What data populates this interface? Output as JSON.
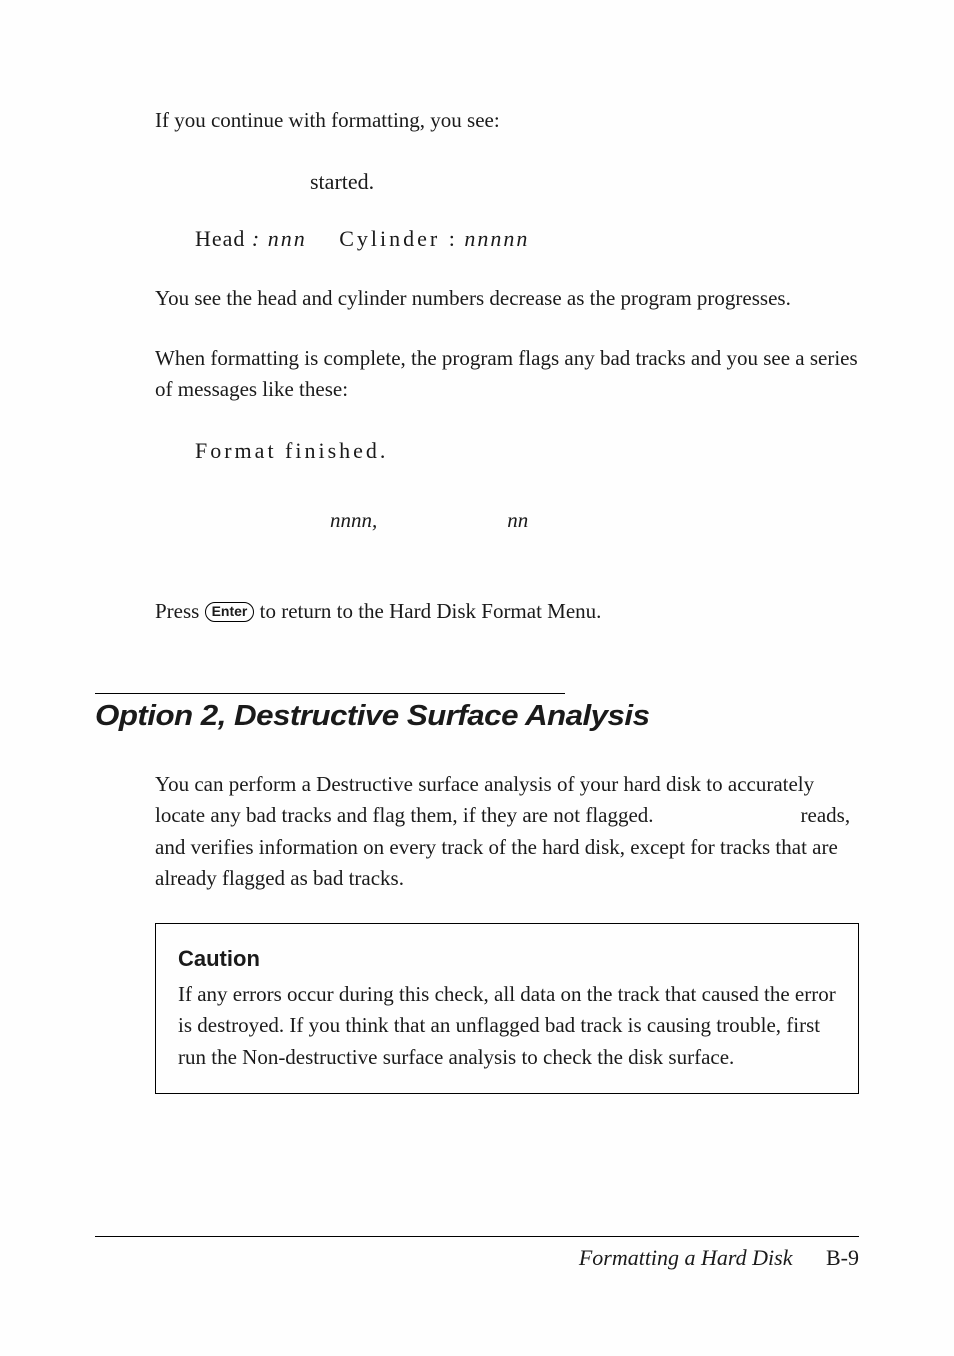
{
  "intro": {
    "line1": "If you continue with formatting, you see:",
    "started": "started.",
    "head_label": "Head",
    "head_colon": ":",
    "head_val": "nnn",
    "cyl_label": "Cylinder :",
    "cyl_val": "nnnnn",
    "progress": "You see the head and cylinder numbers decrease as the program progresses.",
    "complete": "When formatting is complete, the program flags any bad tracks and you see a series of messages like these:",
    "finished": "Format finished.",
    "nnnn": "nnnn,",
    "nn": "nn"
  },
  "press": {
    "prefix": "Press ",
    "key": "Enter",
    "suffix": " to return to the Hard Disk Format Menu."
  },
  "section": {
    "heading": "Option 2, Destructive Surface Analysis",
    "body_full": "You can perform a Destructive surface analysis of your hard disk to accurately locate any bad tracks and flag them, if they are not flagged.                            reads, and verifies information on every track of the hard disk, except for tracks that are already flagged as bad tracks."
  },
  "caution": {
    "title": "Caution",
    "body": "If any errors occur during this check, all data on the track that caused the error is destroyed. If you think that an unflagged bad track is causing trouble, first run the Non-destructive surface analysis to check the disk surface."
  },
  "footer": {
    "title": "Formatting a Hard Disk",
    "page": "B-9"
  }
}
